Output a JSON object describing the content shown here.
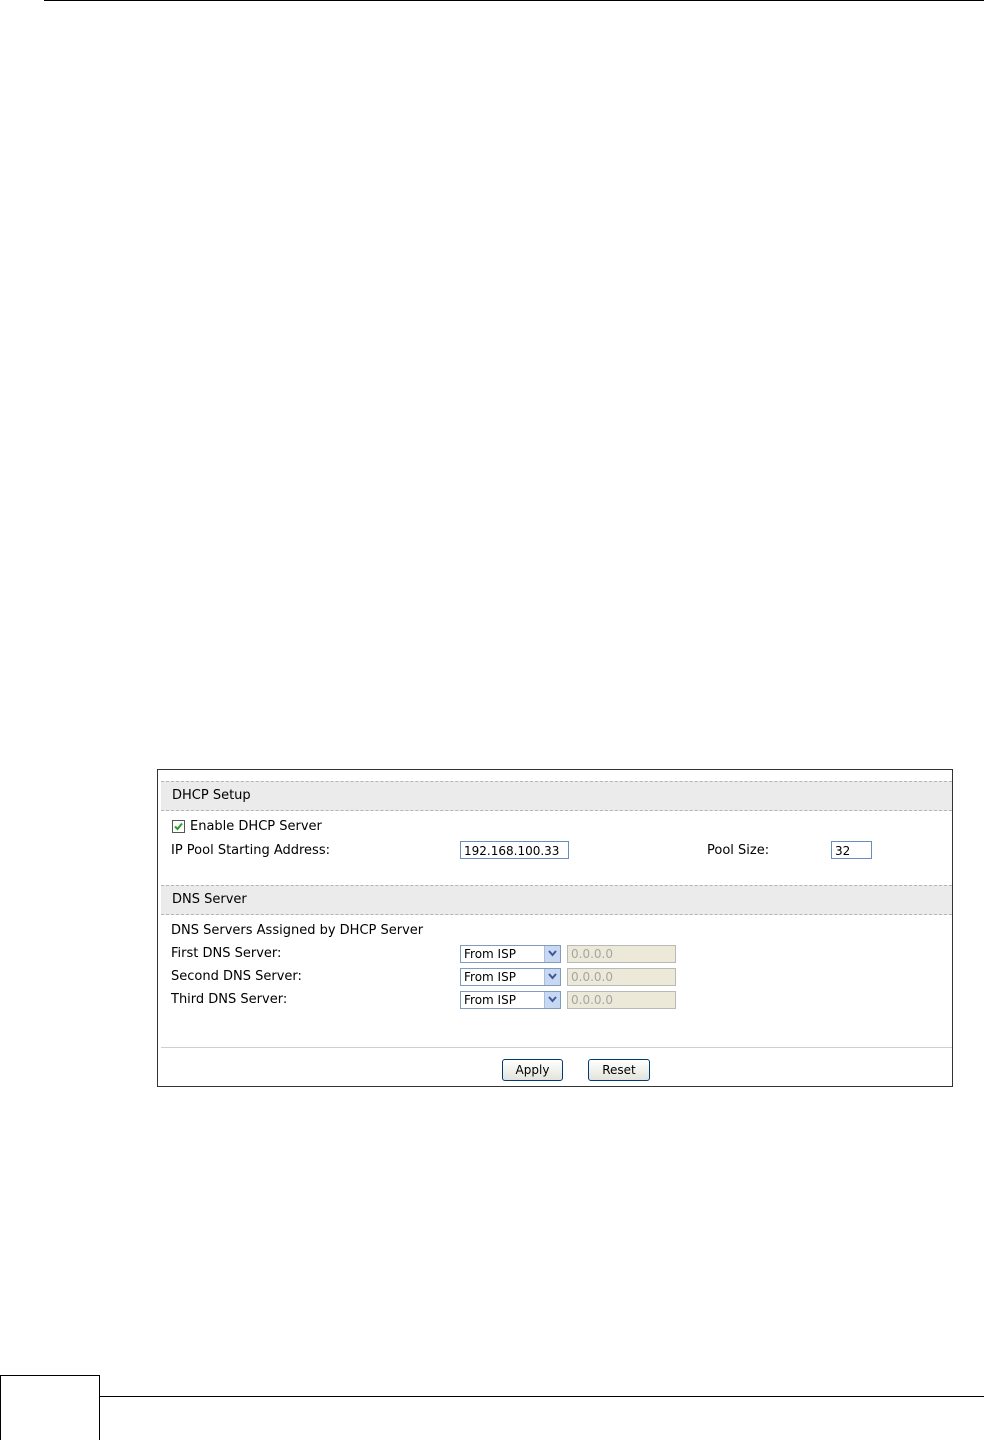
{
  "dhcp_setup": {
    "header": "DHCP Setup",
    "enable_label": "Enable DHCP Server",
    "enable_checked": true,
    "ip_pool_label": "IP Pool Starting Address:",
    "ip_pool_value": "192.168.100.33",
    "pool_size_label": "Pool Size:",
    "pool_size_value": "32"
  },
  "dns_server": {
    "header": "DNS Server",
    "assigned_label": "DNS Servers Assigned by DHCP Server",
    "servers": [
      {
        "label": "First DNS Server:",
        "mode": "From ISP",
        "address": "0.0.0.0"
      },
      {
        "label": "Second DNS Server:",
        "mode": "From ISP",
        "address": "0.0.0.0"
      },
      {
        "label": "Third DNS Server:",
        "mode": "From ISP",
        "address": "0.0.0.0"
      }
    ]
  },
  "buttons": {
    "apply": "Apply",
    "reset": "Reset"
  },
  "icons": {
    "checkbox_check": "check-icon",
    "select_arrow": "chevron-down-icon"
  },
  "colors": {
    "checkmark": "#2a9d2a",
    "header_bg": "#ebebeb",
    "disabled_bg": "#ece9d8"
  }
}
